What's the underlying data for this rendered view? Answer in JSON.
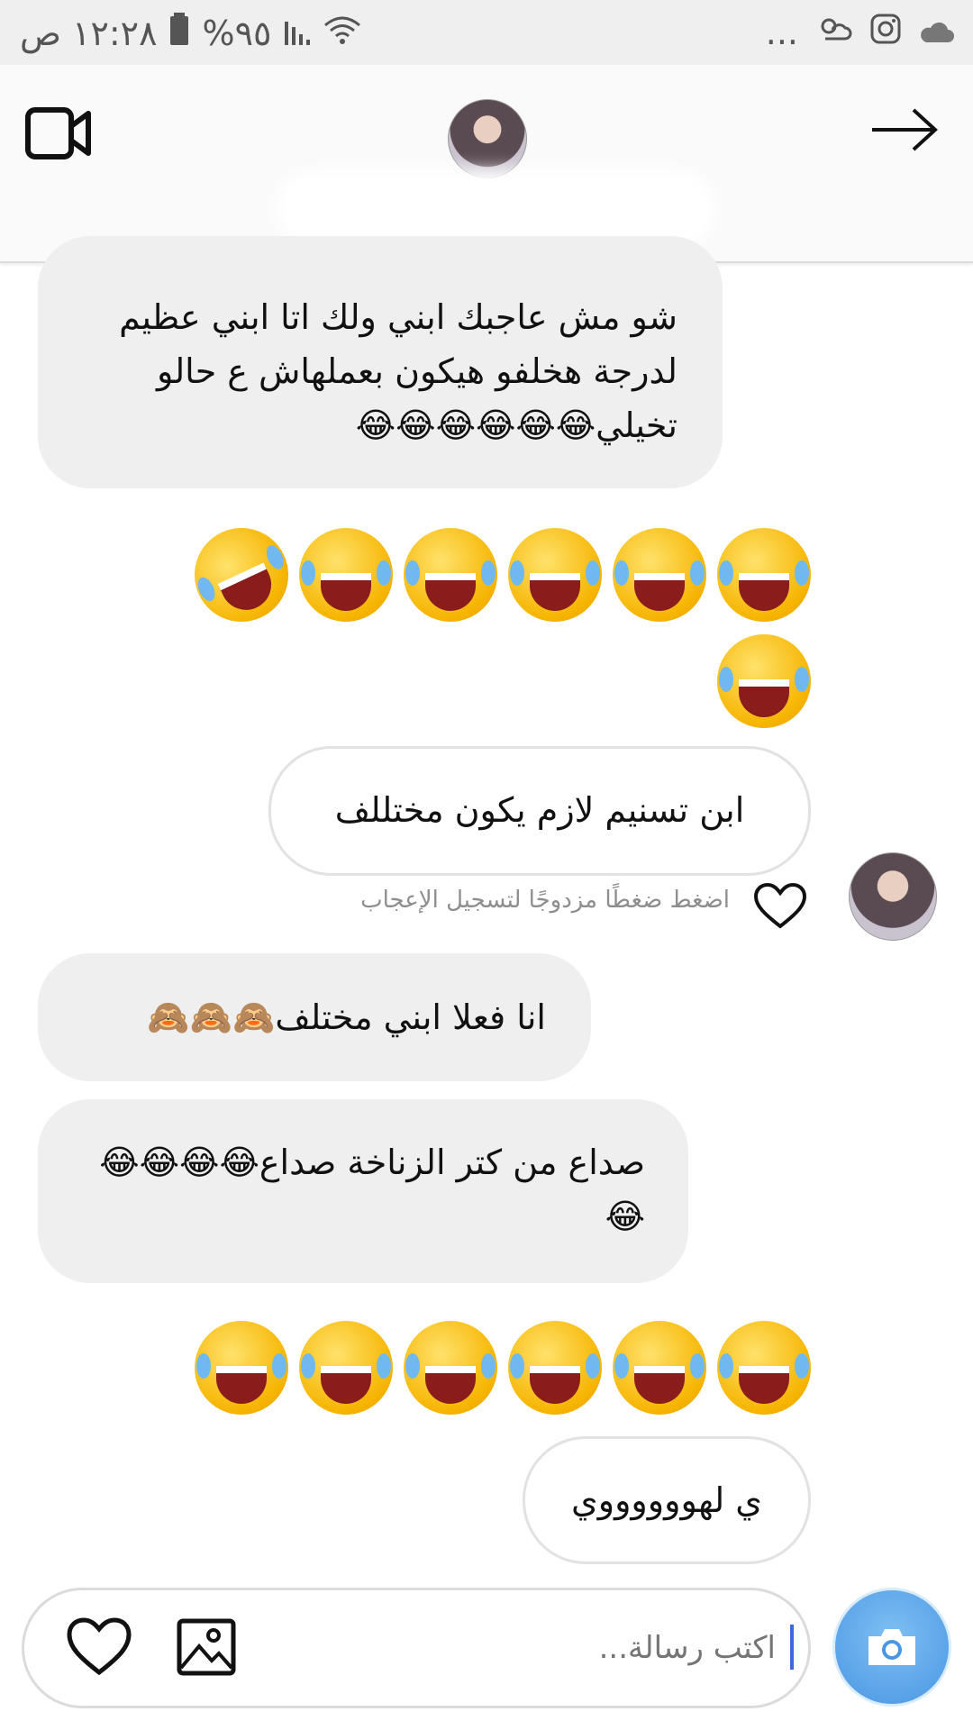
{
  "status_bar": {
    "time": "١٢:٢٨ ص",
    "battery": "%٩٥",
    "more": "..."
  },
  "header": {
    "name": "",
    "icons": {
      "video": "video-camera-icon",
      "back": "arrow-right-icon"
    }
  },
  "messages": [
    {
      "type": "incoming",
      "text": "شو مش عاجبك ابني ولك اتا ابني عظيم لدرجة هخلفو هيكون بعملهاش ع حالو تخيلي😂😂😂😂😂😂"
    },
    {
      "type": "incoming-emoji",
      "emoji": "🤣😂😂😂😂😂😂"
    },
    {
      "type": "outgoing",
      "text": "ابن تسنيم  لازم  يكون  مختللف"
    },
    {
      "type": "incoming",
      "text": "انا فعلا ابني مختلف🙈🙈🙈"
    },
    {
      "type": "incoming",
      "text": "صداع من كتر الزناخة صداع😂😂😂😂😂"
    },
    {
      "type": "incoming-emoji",
      "emoji": "😂😂😂😂😂😂"
    },
    {
      "type": "outgoing",
      "text": "ي لهووووووي"
    }
  ],
  "like_hint": "اضغط ضغطًا مزدوجًا لتسجيل الإعجاب",
  "composer": {
    "placeholder": "اكتب رسالة...",
    "icons": {
      "heart": "heart-icon",
      "image": "image-icon",
      "camera": "camera-icon"
    }
  }
}
